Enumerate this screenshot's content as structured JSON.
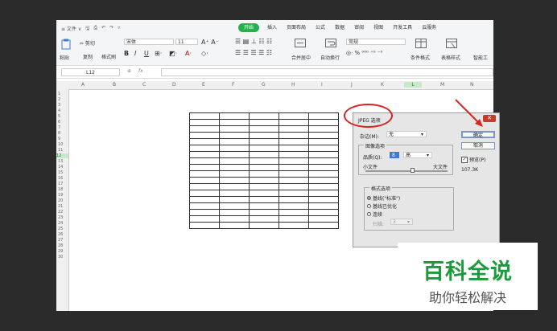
{
  "menubar": {
    "left": [
      "≡ 文件 ∨",
      "🖫",
      "⎙",
      "↶",
      "↷",
      "▿"
    ],
    "tabs": [
      "开始",
      "插入",
      "页面布局",
      "公式",
      "数据",
      "审阅",
      "视图",
      "开发工具",
      "云服务"
    ]
  },
  "ribbon": {
    "paste": "粘贴",
    "cut": "✂ 剪切",
    "copy": "复制",
    "format_painter": "格式刷",
    "font_name": "宋体",
    "font_size": "11",
    "bold": "B",
    "italic": "I",
    "underline": "U",
    "merge_center": "合并居中",
    "wrap": "自动换行",
    "number_format": "常规",
    "cond_format": "条件格式",
    "table_style": "表格样式",
    "smart": "智能工"
  },
  "formula_bar": {
    "name_box": "L12",
    "fx": "fx"
  },
  "columns": [
    "A",
    "B",
    "C",
    "D",
    "E",
    "F",
    "G",
    "H",
    "I",
    "J",
    "K",
    "L",
    "M",
    "N"
  ],
  "rows": [
    "1",
    "2",
    "3",
    "4",
    "5",
    "6",
    "7",
    "8",
    "9",
    "10",
    "11",
    "12",
    "13",
    "14",
    "15",
    "16",
    "17",
    "18",
    "19",
    "20",
    "21",
    "22",
    "23",
    "24",
    "25",
    "26",
    "27",
    "28",
    "29",
    "30"
  ],
  "dialog": {
    "title": "JPEG 选项",
    "matte_label": "杂边(M):",
    "matte_value": "无",
    "image_options_label": "图像选项",
    "quality_label": "品质(Q):",
    "quality_value": "8",
    "quality_level": "高",
    "small_file": "小文件",
    "large_file": "大文件",
    "format_options_label": "格式选项",
    "format_baseline_standard": "基线(\"标准\")",
    "format_baseline_optimized": "基线已优化",
    "format_progressive": "连续",
    "scans_label": "扫描:",
    "scans_value": "3",
    "ok": "确定",
    "cancel": "取消",
    "preview": "预览(P)",
    "file_size": "107.3K"
  },
  "watermark": {
    "title": "百科全说",
    "subtitle": "助你轻松解决"
  },
  "colors": {
    "accent": "#22b14c",
    "annotation": "#d9231f",
    "watermark": "#1a9b3c"
  }
}
